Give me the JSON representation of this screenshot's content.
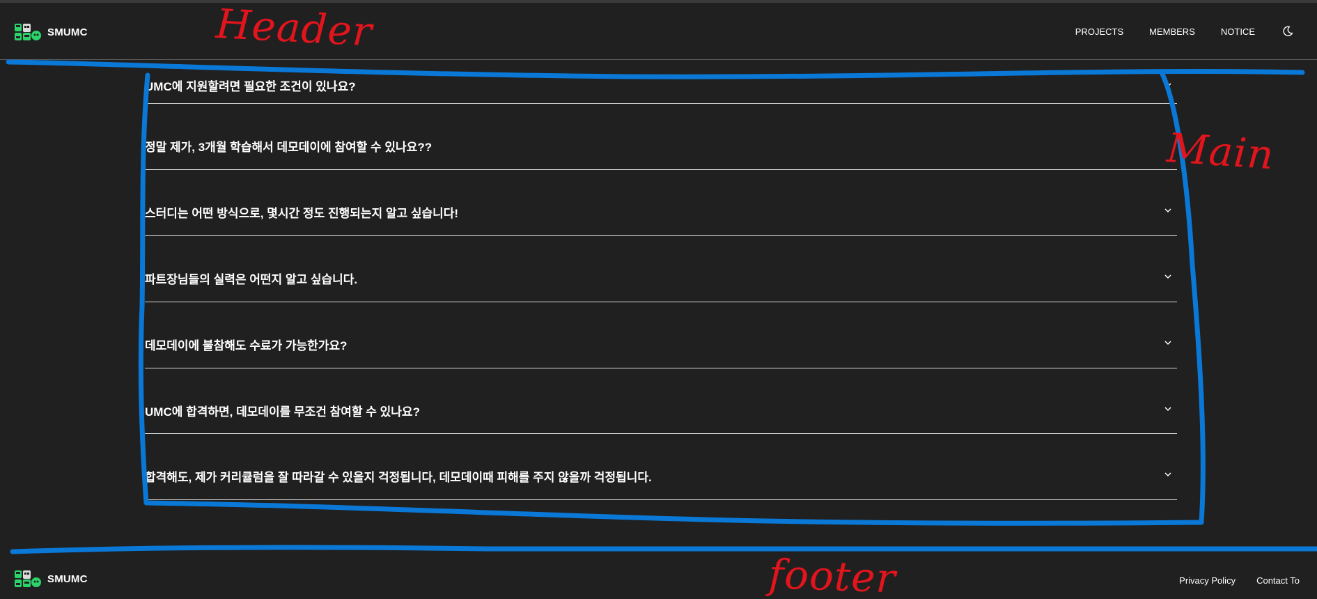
{
  "header": {
    "brand": "SMUMC",
    "nav": [
      {
        "label": "PROJECTS"
      },
      {
        "label": "MEMBERS"
      },
      {
        "label": "NOTICE"
      }
    ],
    "theme_icon": "moon-icon"
  },
  "faq": {
    "items": [
      {
        "question": "UMC에 지원할려면 필요한 조건이 있나요?"
      },
      {
        "question": "정말 제가, 3개월 학습해서 데모데이에 참여할 수 있나요??"
      },
      {
        "question": "스터디는 어떤 방식으로, 몇시간 정도 진행되는지 알고 싶습니다!"
      },
      {
        "question": "파트장님들의 실력은 어떤지 알고 싶습니다."
      },
      {
        "question": "데모데이에 불참해도 수료가 가능한가요?"
      },
      {
        "question": "UMC에 합격하면, 데모데이를 무조건 참여할 수 있나요?"
      },
      {
        "question": "합격해도, 제가 커리큘럼을 잘 따라갈 수 있을지 걱정됩니다, 데모데이때 피해를 주지 않을까 걱정됩니다."
      }
    ],
    "chevron_icon": "chevron-down-icon"
  },
  "footer": {
    "brand": "SMUMC",
    "links": [
      {
        "label": "Privacy Policy"
      },
      {
        "label": "Contact To"
      }
    ]
  },
  "annotations": {
    "header_label": "Header",
    "main_label": "Main",
    "footer_label": "footer",
    "line_color": "#0a78d6",
    "text_color": "#e2141c"
  }
}
